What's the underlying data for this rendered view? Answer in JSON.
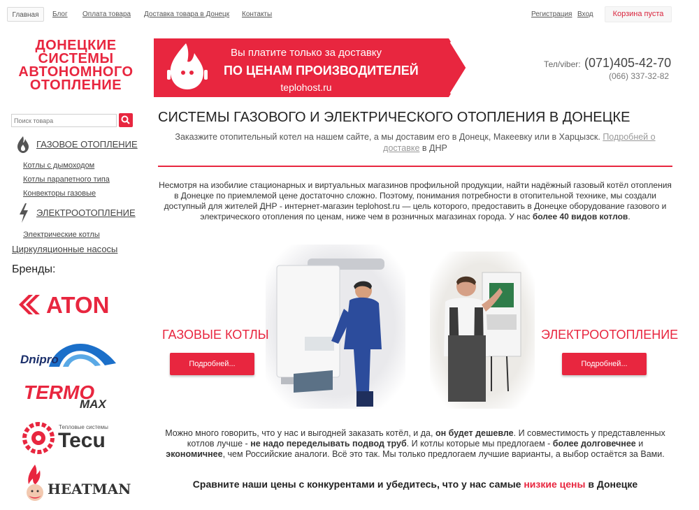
{
  "nav": {
    "home": "Главная",
    "blog": "Блог",
    "payment": "Оплата товара",
    "delivery": "Доставка товара в Донецк",
    "contacts": "Контакты",
    "register": "Регистрация",
    "login": "Вход",
    "cart": "Корзина пуста"
  },
  "logo": {
    "line1": "ДОНЕЦКИЕ",
    "line2": "СИСТЕМЫ",
    "line3": "АВТОНОМНОГО",
    "line4": "ОТОПЛЕНИЕ"
  },
  "banner": {
    "line1": "Вы платите только за доставку",
    "line2": "ПО ЦЕНАМ ПРОИЗВОДИТЕЛЕЙ",
    "line3": "teplohost.ru"
  },
  "contacts": {
    "label": "Тел/viber:",
    "phone_main": "(071)405-42-70",
    "phone_secondary": "(066) 337-32-82"
  },
  "search": {
    "placeholder": "Поиск товара"
  },
  "sidebar": {
    "gas_heating": "ГАЗОВОЕ ОТОПЛЕНИЕ",
    "gas_items": [
      "Котлы с дымоходом",
      "Котлы парапетного типа",
      "Конвекторы газовые"
    ],
    "electric_heating": "ЭЛЕКТРООТОПЛЕНИЕ",
    "electric_items": [
      "Электрические котлы"
    ],
    "pumps": "Циркуляционные насосы",
    "brands_title": "Бренды:"
  },
  "brands": {
    "aton": "ATON",
    "dnipro": "Dnipro",
    "termo": "TERMO",
    "max": "MAX",
    "tecu_small": "Тепловые системы",
    "tecu": "Tecu",
    "heatman": "HEATMAN"
  },
  "main": {
    "title": "СИСТЕМЫ ГАЗОВОГО И ЭЛЕКТРИЧЕСКОГО ОТОПЛЕНИЯ В ДОНЕЦКЕ",
    "intro": "Заказжите отопительный котел на нашем сайте, а мы доставим его в Донецк, Макеевку или в Харцызск.",
    "intro_link": "Подробней о доставке",
    "intro_tail": "в ДНР",
    "para1": "Несмотря на изобилие стационарных и виртуальных магазинов профильной продукции, найти надёжный газовый котёл отопления в Донецке по приемлемой цене достаточно сложно. Поэтому, понимания потребности в отопительной технике, мы создали доступный для жителей ДНР - интернет-магазин teplohost.ru — цель которого, предоставить в Донецке оборудование газового и электрического отопления по ценам, ниже чем в розничных магазинах города. У нас",
    "para1_bold": "более 40 видов котлов",
    "para1_end": ".",
    "gas_title": "ГАЗОВЫЕ КОТЛЫ",
    "el_title": "ЭЛЕКТРООТОПЛЕНИЕ",
    "more": "Подробней...",
    "para2_a": "Можно много говорить, что у нас и выгодней заказать котёл, и да,",
    "para2_b": "он будет дешевле",
    "para2_c": ". И совместимость у представленных котлов лучше -",
    "para2_d": "не надо переделывать подвод труб",
    "para2_e": ". И котлы которые мы предлогаем -",
    "para2_f": "более долговечнее",
    "para2_g": "и",
    "para2_h": "экономичнее",
    "para2_i": ", чем Российские аналоги. Всё это так. Мы только предлогаем лучшие варианты, а выбор остаётся за Вами.",
    "compare_a": "Сравните наши цены с конкурентами и убедитесь, что у нас самые",
    "compare_b": "низкие цены",
    "compare_c": "в Донецке"
  },
  "colors": {
    "accent": "#e8263f",
    "navy": "#1b2f6b"
  }
}
